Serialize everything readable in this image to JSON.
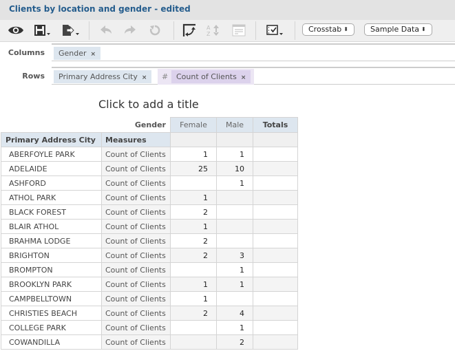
{
  "window": {
    "title": "Clients by location and gender - edited"
  },
  "toolbar": {
    "icons": [
      "view-icon",
      "save-icon",
      "export-icon",
      "undo-icon",
      "redo-icon",
      "reset-icon",
      "swap-axes-icon",
      "sort-icon",
      "layout-icon",
      "options-icon"
    ],
    "report_type": "Crosstab",
    "data_source": "Sample Data",
    "select_arrows": "▲▼"
  },
  "shelves": {
    "columns_label": "Columns",
    "rows_label": "Rows",
    "columns": [
      {
        "label": "Gender",
        "remove": "×"
      }
    ],
    "rows": [
      {
        "label": "Primary Address City",
        "remove": "×"
      }
    ],
    "measures_hash": "#",
    "measures": [
      {
        "label": "Count of Clients",
        "remove": "×"
      }
    ]
  },
  "report": {
    "title_placeholder": "Click to add a title",
    "column_dimension": "Gender",
    "columns": [
      "Female",
      "Male"
    ],
    "totals_label": "Totals",
    "row_header": "Primary Address City",
    "measures_header": "Measures",
    "rows": [
      {
        "city": "ABERFOYLE PARK",
        "measure": "Count of Clients",
        "female": "1",
        "male": "1",
        "total": ""
      },
      {
        "city": "ADELAIDE",
        "measure": "Count of Clients",
        "female": "25",
        "male": "10",
        "total": ""
      },
      {
        "city": "ASHFORD",
        "measure": "Count of Clients",
        "female": "",
        "male": "1",
        "total": ""
      },
      {
        "city": "ATHOL PARK",
        "measure": "Count of Clients",
        "female": "1",
        "male": "",
        "total": ""
      },
      {
        "city": "BLACK FOREST",
        "measure": "Count of Clients",
        "female": "2",
        "male": "",
        "total": ""
      },
      {
        "city": "BLAIR ATHOL",
        "measure": "Count of Clients",
        "female": "1",
        "male": "",
        "total": ""
      },
      {
        "city": "BRAHMA LODGE",
        "measure": "Count of Clients",
        "female": "2",
        "male": "",
        "total": ""
      },
      {
        "city": "BRIGHTON",
        "measure": "Count of Clients",
        "female": "2",
        "male": "3",
        "total": ""
      },
      {
        "city": "BROMPTON",
        "measure": "Count of Clients",
        "female": "",
        "male": "1",
        "total": ""
      },
      {
        "city": "BROOKLYN PARK",
        "measure": "Count of Clients",
        "female": "1",
        "male": "1",
        "total": ""
      },
      {
        "city": "CAMPBELLTOWN",
        "measure": "Count of Clients",
        "female": "1",
        "male": "",
        "total": ""
      },
      {
        "city": "CHRISTIES BEACH",
        "measure": "Count of Clients",
        "female": "2",
        "male": "4",
        "total": ""
      },
      {
        "city": "COLLEGE PARK",
        "measure": "Count of Clients",
        "female": "",
        "male": "1",
        "total": ""
      },
      {
        "city": "COWANDILLA",
        "measure": "Count of Clients",
        "female": "",
        "male": "2",
        "total": ""
      }
    ]
  }
}
